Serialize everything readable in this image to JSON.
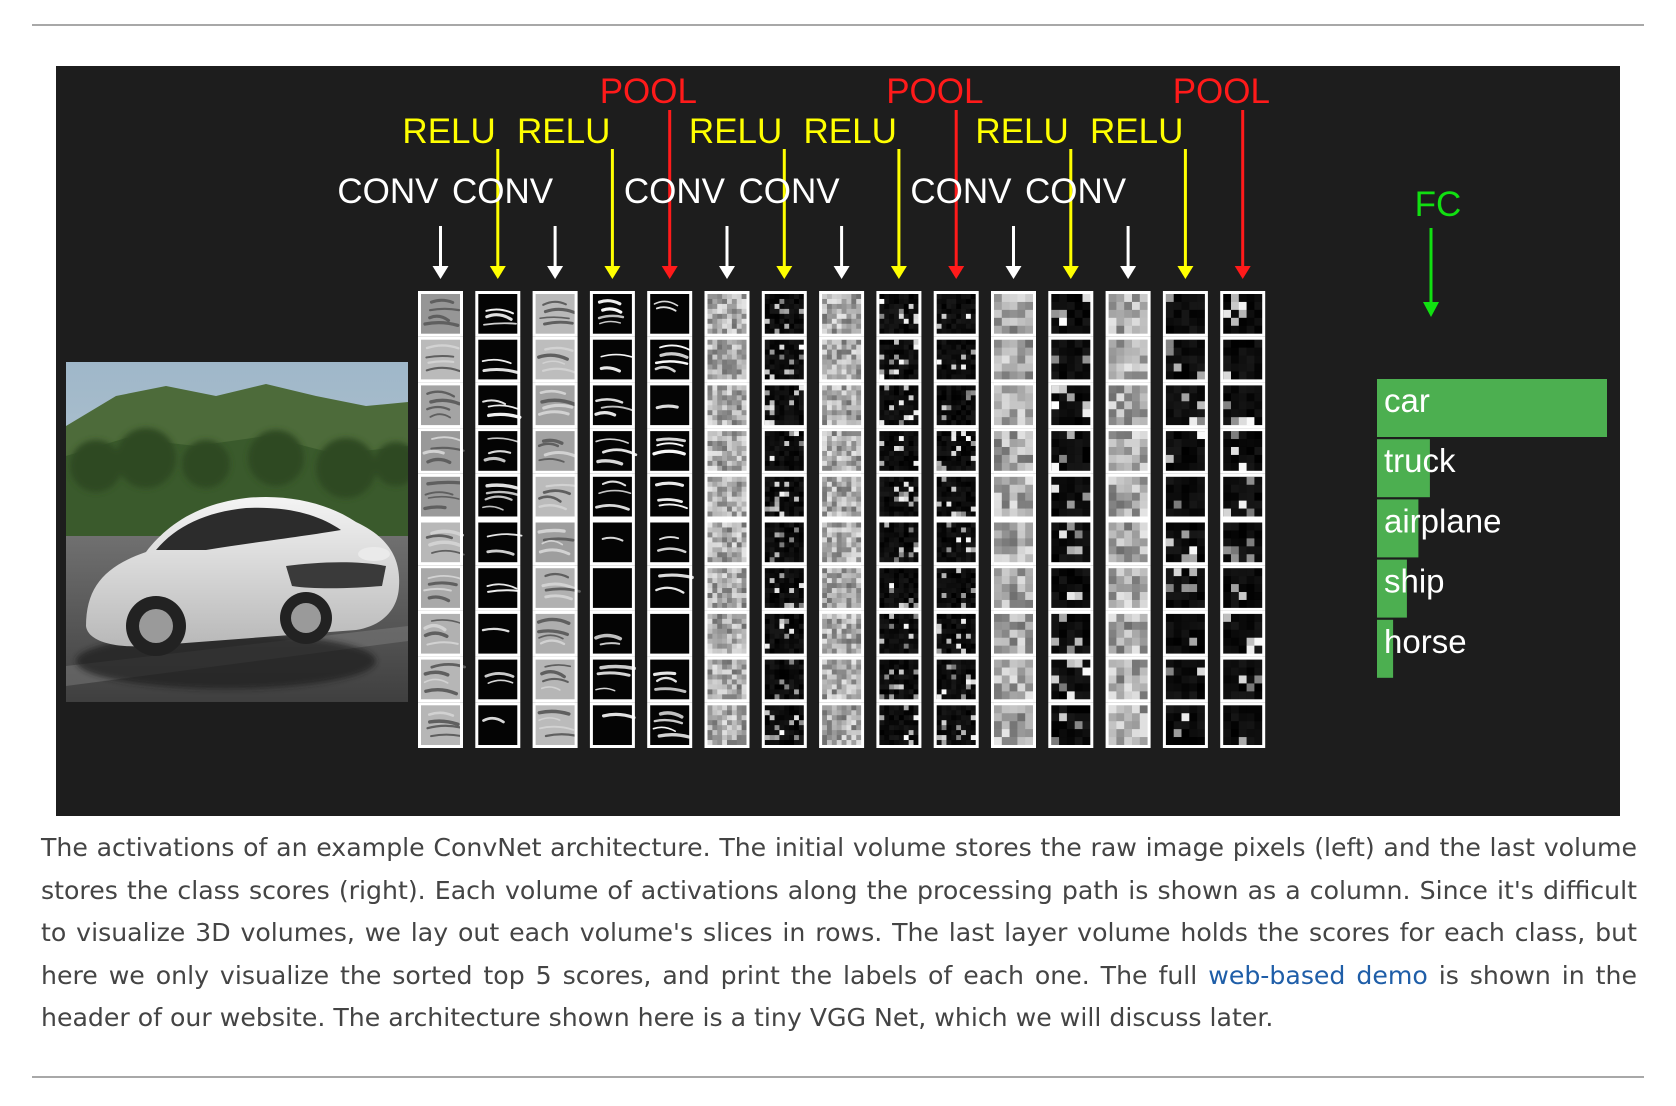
{
  "figure": {
    "layer_labels": {
      "conv": "CONV",
      "relu": "RELU",
      "pool": "POOL",
      "fc": "FC"
    },
    "columns": [
      "CONV",
      "RELU",
      "CONV",
      "RELU",
      "POOL",
      "CONV",
      "RELU",
      "CONV",
      "RELU",
      "POOL",
      "CONV",
      "RELU",
      "CONV",
      "RELU",
      "POOL"
    ],
    "rows_per_column": 10,
    "colors": {
      "conv_arrow": "#ffffff",
      "relu": "#ffff00",
      "pool": "#ff1a1a",
      "fc": "#11e011",
      "score_bar": "#4caf50",
      "background": "#1d1d1d"
    },
    "class_scores": [
      {
        "label": "car",
        "score": 1.0
      },
      {
        "label": "truck",
        "score": 0.23
      },
      {
        "label": "airplane",
        "score": 0.18
      },
      {
        "label": "ship",
        "score": 0.13
      },
      {
        "label": "horse",
        "score": 0.07
      }
    ]
  },
  "caption": {
    "part1": "The activations of an example ConvNet architecture. The initial volume stores the raw image pixels (left) and the last volume stores the class scores (right). Each volume of activations along the processing path is shown as a column. Since it's difficult to visualize 3D volumes, we lay out each volume's slices in rows. The last layer volume holds the scores for each class, but here we only visualize the sorted top 5 scores, and print the labels of each one. The full ",
    "link_text": "web-based demo",
    "part2": " is shown in the header of our website. The architecture shown here is a tiny VGG Net, which we will discuss later."
  }
}
